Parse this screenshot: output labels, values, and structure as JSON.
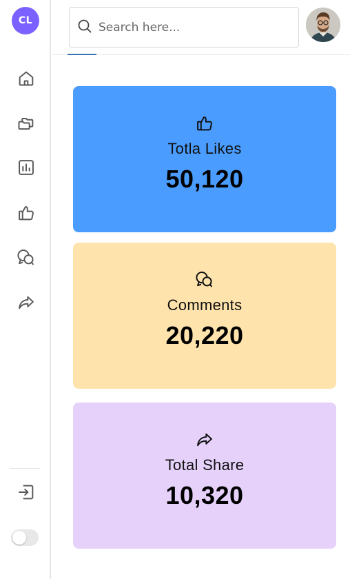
{
  "sidebar": {
    "logo_text": "CL",
    "items": [
      {
        "name": "home",
        "icon": "home-icon"
      },
      {
        "name": "folders",
        "icon": "folders-icon"
      },
      {
        "name": "analytics",
        "icon": "bar-chart-icon"
      },
      {
        "name": "likes",
        "icon": "thumbs-up-icon"
      },
      {
        "name": "comments",
        "icon": "chat-bubbles-icon"
      },
      {
        "name": "share",
        "icon": "share-arrow-icon"
      }
    ],
    "logout_icon": "logout-icon",
    "theme_toggle": {
      "state": "off"
    }
  },
  "header": {
    "search": {
      "placeholder": "Search here...",
      "value": ""
    },
    "avatar_icon": "user-avatar"
  },
  "cards": [
    {
      "label": "Totla Likes",
      "value": "50,120",
      "icon": "thumbs-up-icon",
      "color": "#4a9dff"
    },
    {
      "label": "Comments",
      "value": "20,220",
      "icon": "chat-bubbles-icon",
      "color": "#fee4ac"
    },
    {
      "label": "Total Share",
      "value": "10,320",
      "icon": "share-arrow-icon",
      "color": "#e6d1fb"
    }
  ],
  "colors": {
    "accent": "#7b61ff",
    "icon_gray": "#5a5a5a"
  }
}
